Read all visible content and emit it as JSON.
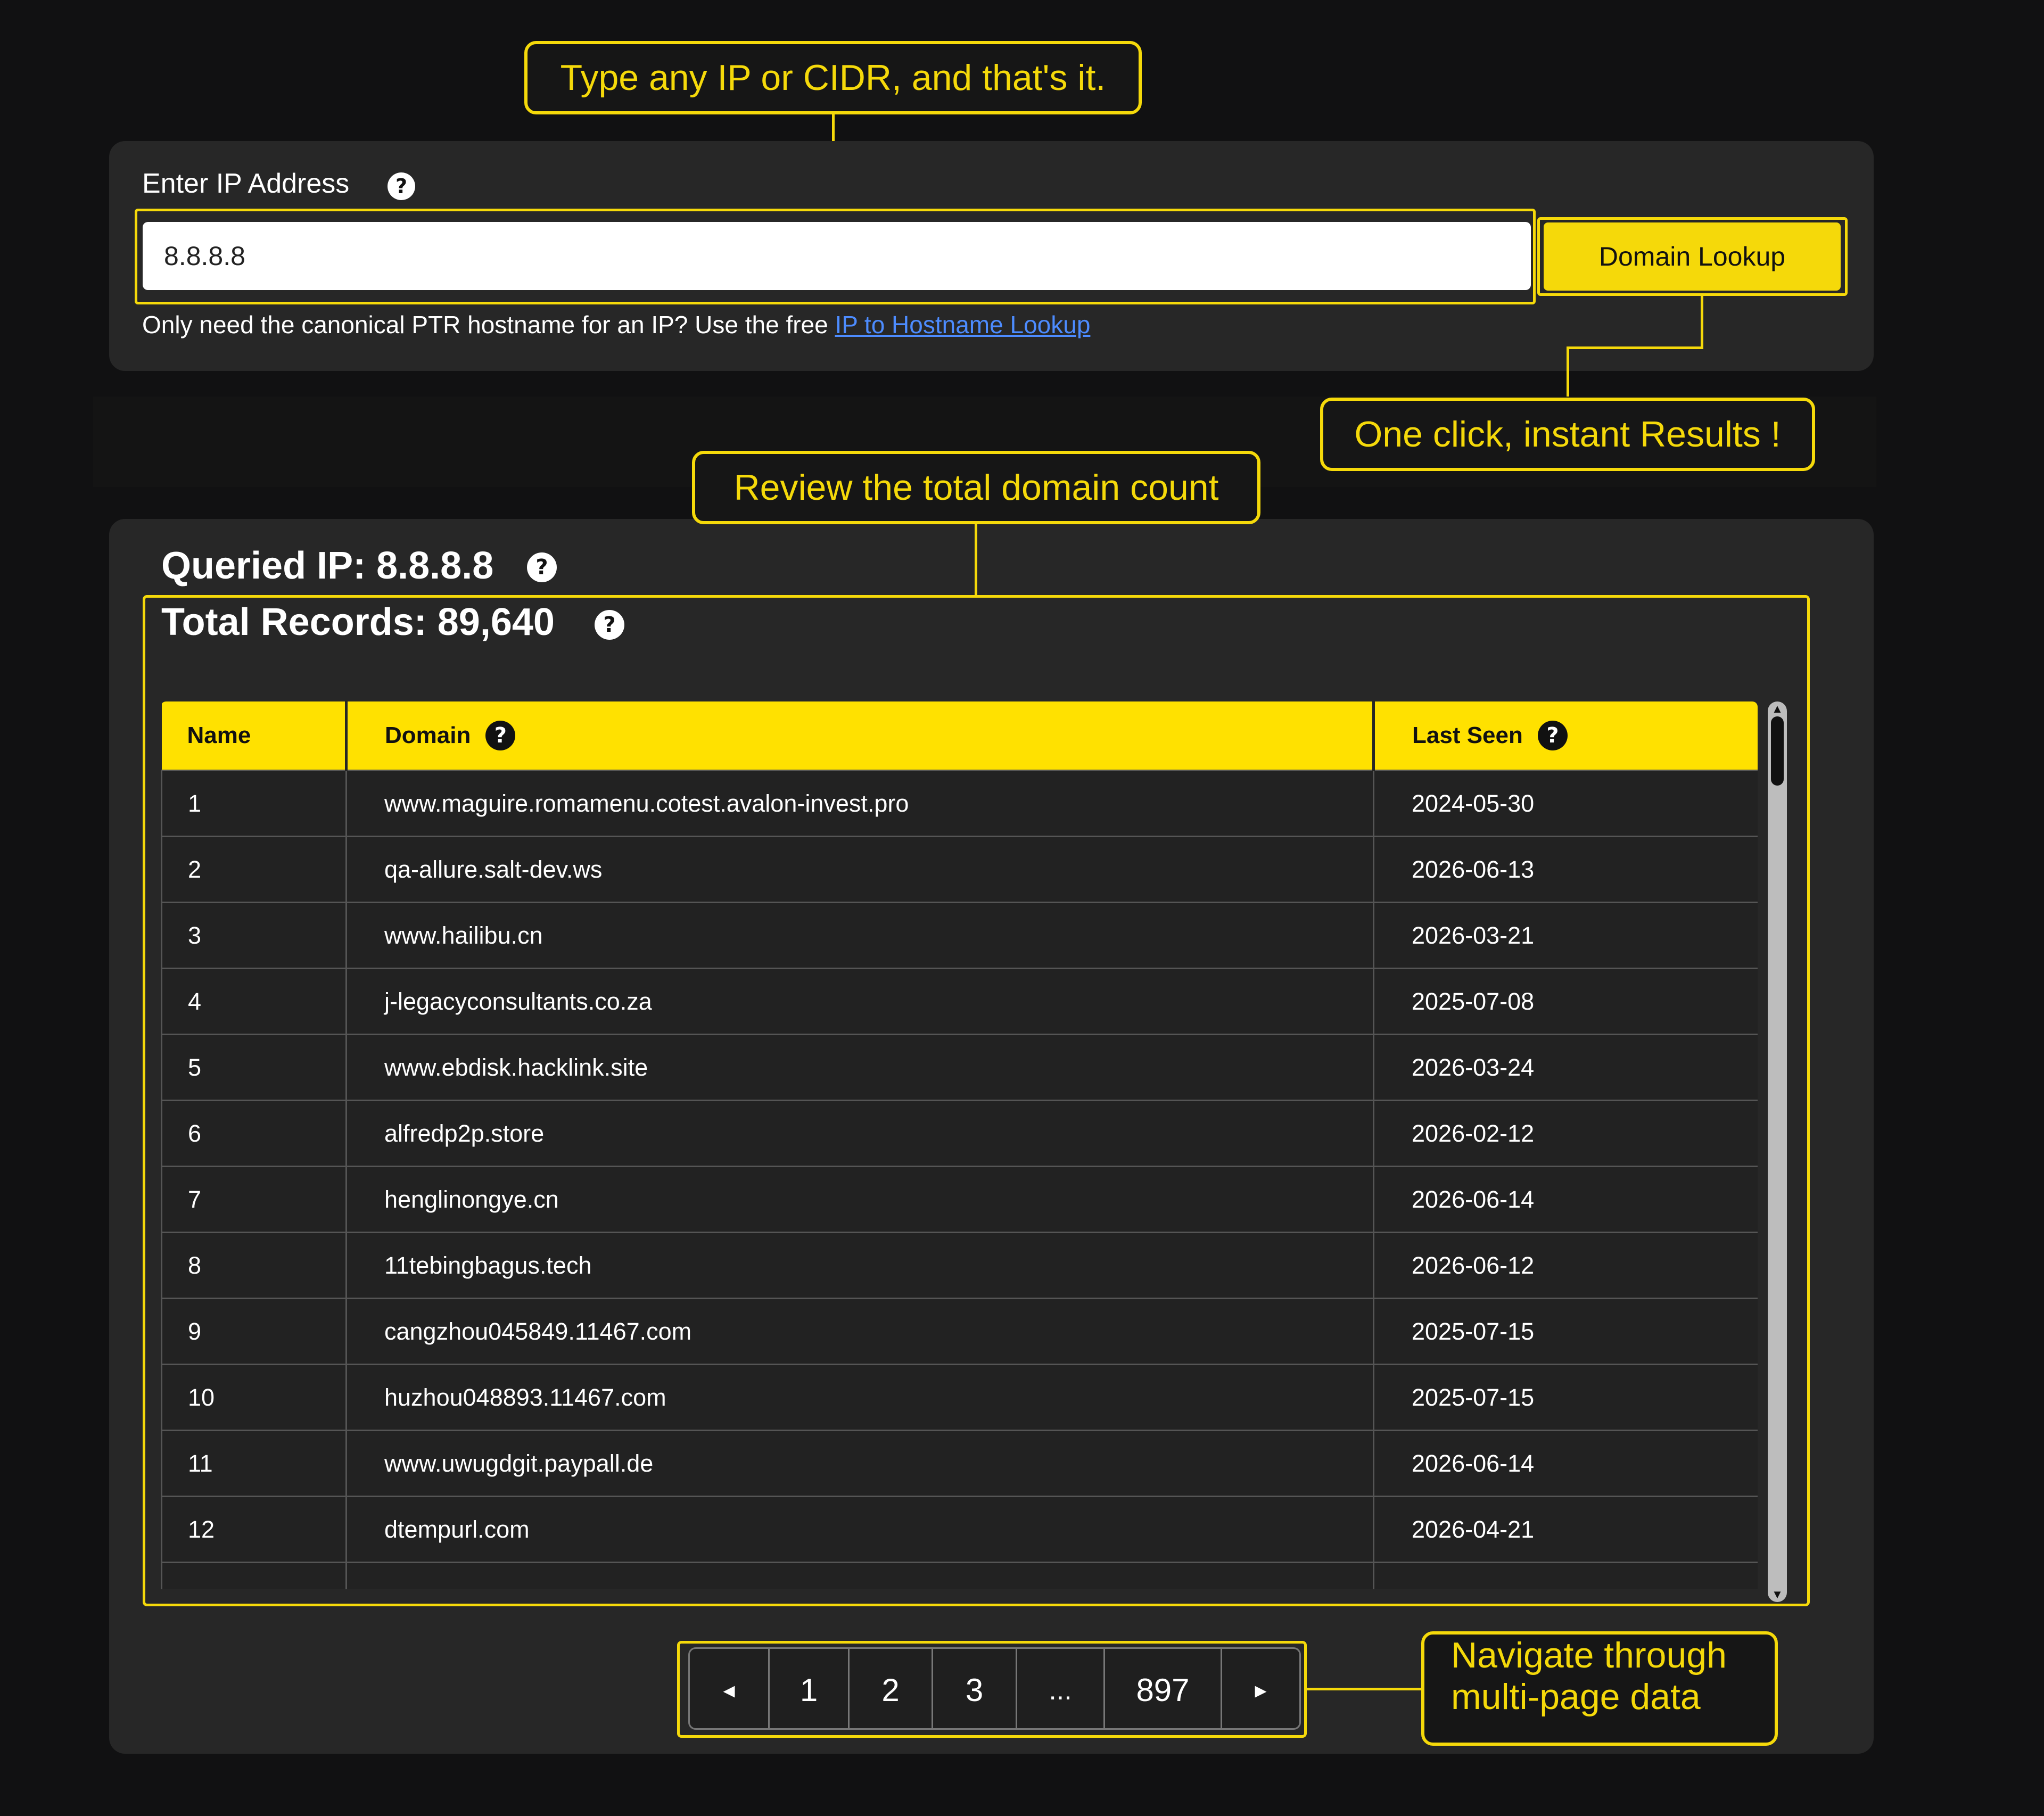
{
  "callouts": {
    "type": "Type any IP or CIDR, and that's it.",
    "click": "One click, instant Results !",
    "review": "Review the total domain count",
    "navigate_line1": "Navigate through",
    "navigate_line2": "multi-page data"
  },
  "input_panel": {
    "label": "Enter IP Address",
    "help_glyph": "?",
    "ip_value": "8.8.8.8",
    "button_label": "Domain Lookup",
    "hint_prefix": "Only need the canonical PTR hostname for an IP? Use the free ",
    "hint_link": "IP to Hostname Lookup"
  },
  "results": {
    "queried_ip": "Queried IP: 8.8.8.8",
    "total_records": "Total Records: 89,640",
    "columns": {
      "name": "Name",
      "domain": "Domain",
      "last_seen": "Last Seen"
    },
    "rows": [
      {
        "name": "1",
        "domain": "www.maguire.romamenu.cotest.avalon-invest.pro",
        "last_seen": "2024-05-30"
      },
      {
        "name": "2",
        "domain": "qa-allure.salt-dev.ws",
        "last_seen": "2026-06-13"
      },
      {
        "name": "3",
        "domain": "www.hailibu.cn",
        "last_seen": "2026-03-21"
      },
      {
        "name": "4",
        "domain": "j-legacyconsultants.co.za",
        "last_seen": "2025-07-08"
      },
      {
        "name": "5",
        "domain": "www.ebdisk.hacklink.site",
        "last_seen": "2026-03-24"
      },
      {
        "name": "6",
        "domain": "alfredp2p.store",
        "last_seen": "2026-02-12"
      },
      {
        "name": "7",
        "domain": "henglinongye.cn",
        "last_seen": "2026-06-14"
      },
      {
        "name": "8",
        "domain": "11tebingbagus.tech",
        "last_seen": "2026-06-12"
      },
      {
        "name": "9",
        "domain": "cangzhou045849.11467.com",
        "last_seen": "2025-07-15"
      },
      {
        "name": "10",
        "domain": "huzhou048893.11467.com",
        "last_seen": "2025-07-15"
      },
      {
        "name": "11",
        "domain": "www.uwugdgit.paypall.de",
        "last_seen": "2026-06-14"
      },
      {
        "name": "12",
        "domain": "dtempurl.com",
        "last_seen": "2026-04-21"
      },
      {
        "name": "",
        "domain": "",
        "last_seen": ""
      }
    ]
  },
  "pagination": {
    "prev": "◂",
    "pages": [
      "1",
      "2",
      "3",
      "...",
      "897"
    ],
    "next": "▸"
  },
  "colors": {
    "accent": "#f5d90a",
    "header": "#ffe100",
    "link": "#4d8cff",
    "panel": "#272727"
  }
}
